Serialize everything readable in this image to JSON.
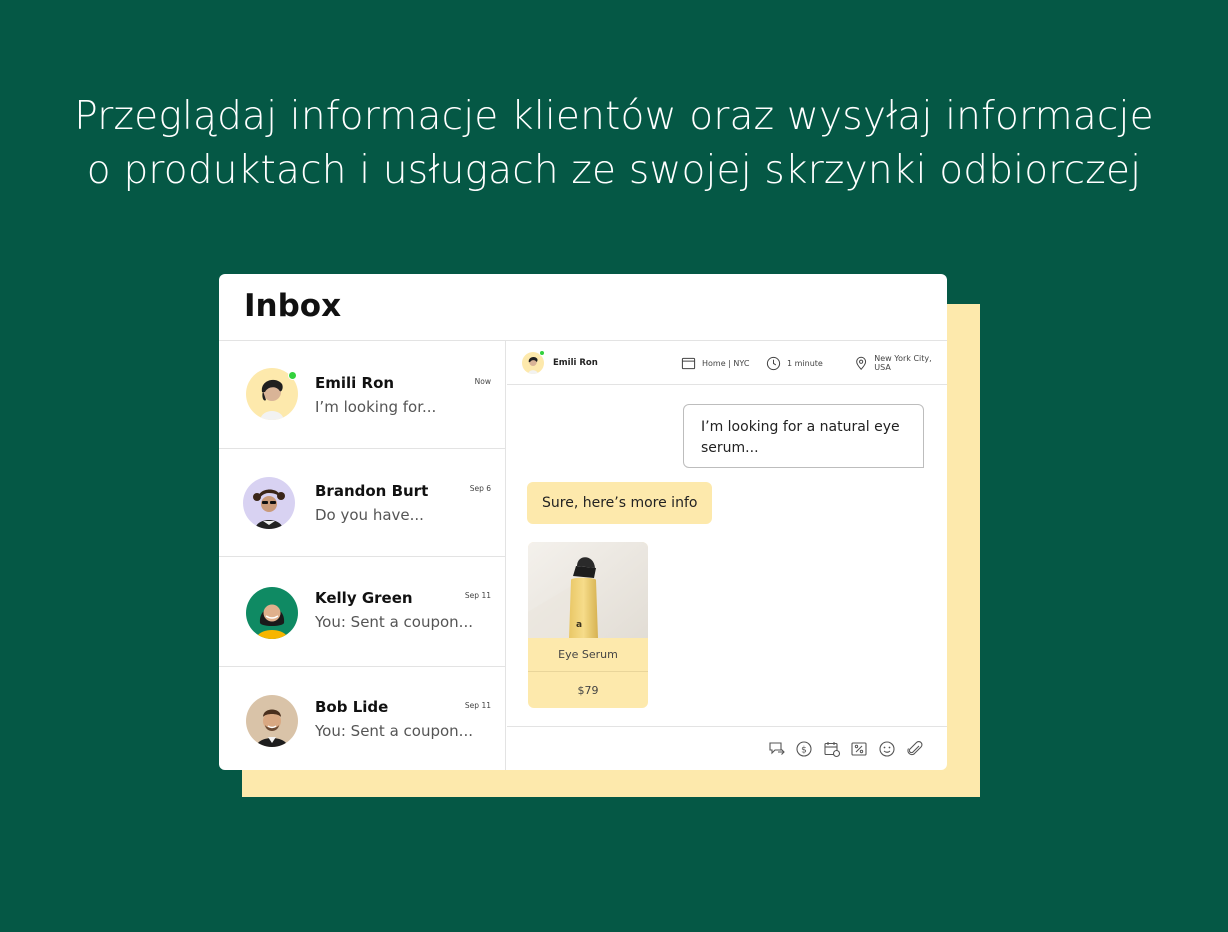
{
  "headline": {
    "line1": "Przeglądaj informacje klientów oraz wysyłaj informacje",
    "line2": "o produktach i usługach ze swojej skrzynki odbiorczej"
  },
  "inbox": {
    "title": "Inbox",
    "conversations": [
      {
        "name": "Emili Ron",
        "preview": "I’m looking for...",
        "date": "Now",
        "online": true
      },
      {
        "name": "Brandon Burt",
        "preview": "Do you have...",
        "date": "Sep 6",
        "online": false
      },
      {
        "name": "Kelly Green",
        "preview": "You: Sent a coupon...",
        "date": "Sep 11",
        "online": false
      },
      {
        "name": "Bob Lide",
        "preview": "You: Sent a coupon...",
        "date": "Sep 11",
        "online": false
      }
    ]
  },
  "chat": {
    "contact_name": "Emili Ron",
    "page": "Home | NYC",
    "time": "1 minute",
    "location": "New York City, USA",
    "messages": {
      "outgoing": "I’m looking for a natural eye serum...",
      "incoming": "Sure, here’s more info"
    },
    "product": {
      "name": "Eye Serum",
      "price": "$79",
      "bottle_letter": "a"
    },
    "toolbar_icons": [
      "chat-forward-icon",
      "dollar-icon",
      "calendar-icon",
      "coupon-icon",
      "emoji-icon",
      "attachment-icon"
    ]
  },
  "colors": {
    "background": "#055845",
    "accent_yellow": "#fde9ac",
    "online": "#33d13d"
  }
}
